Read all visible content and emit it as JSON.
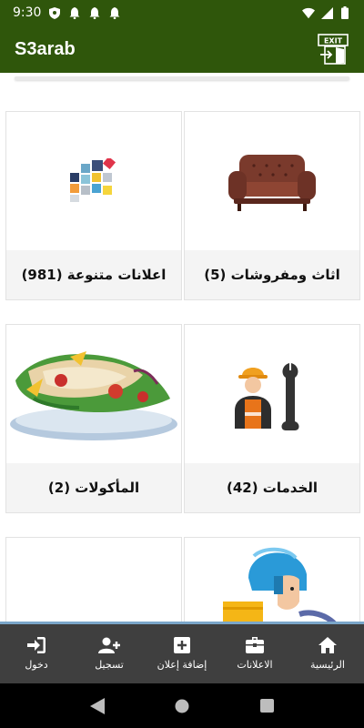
{
  "status": {
    "time": "9:30"
  },
  "app": {
    "title": "S3arab",
    "exit_icon": "exit-door-icon"
  },
  "categories": [
    {
      "label": "اثاث ومفروشات (5)",
      "icon": "sofa"
    },
    {
      "label": "اعلانات متنوعة (981)",
      "icon": "colored-squares"
    },
    {
      "label": "الخدمات (42)",
      "icon": "worker-wrench"
    },
    {
      "label": "المأكولات (2)",
      "icon": "food-wrap-plate"
    },
    {
      "label": "",
      "icon": "delivery-scooter"
    },
    {
      "label": "",
      "icon": "horse"
    }
  ],
  "bottom_nav": [
    {
      "label": "الرئيسية",
      "icon": "home-icon"
    },
    {
      "label": "الاعلانات",
      "icon": "briefcase-icon"
    },
    {
      "label": "إضافة إعلان",
      "icon": "plus-box-icon"
    },
    {
      "label": "تسجيل",
      "icon": "add-user-icon"
    },
    {
      "label": "دخول",
      "icon": "login-icon"
    }
  ],
  "colors": {
    "primary": "#2f560b",
    "nav_bg": "#3f3f3f"
  }
}
